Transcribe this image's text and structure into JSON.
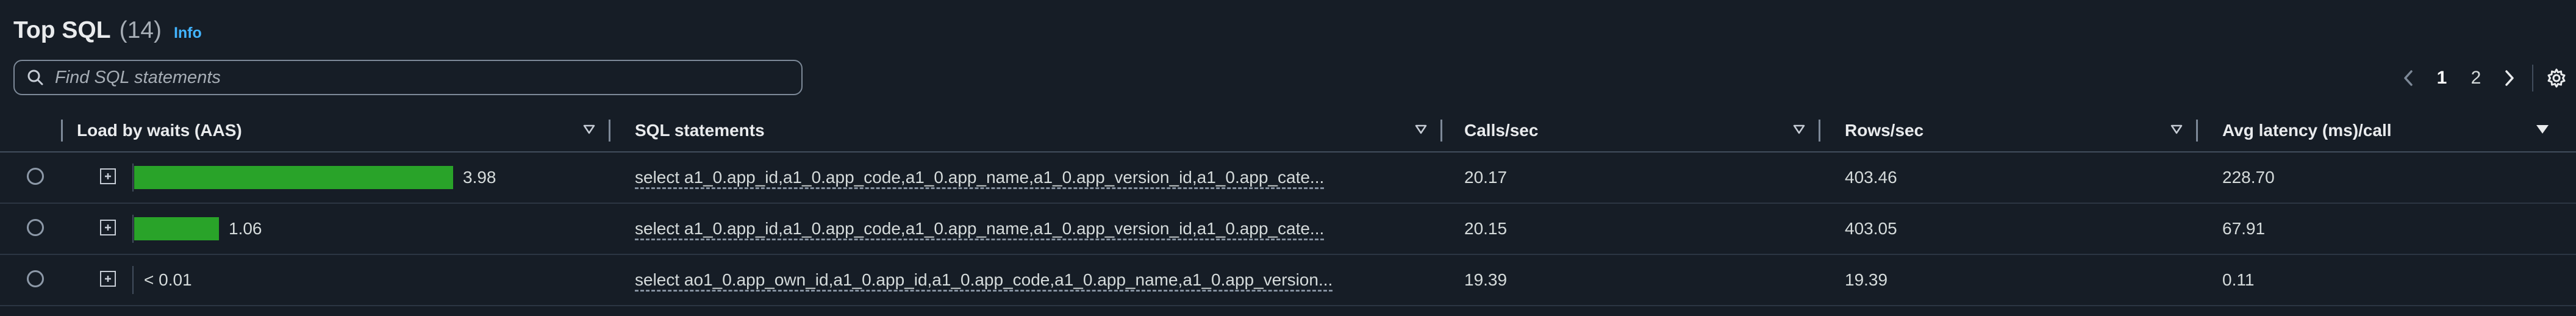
{
  "header": {
    "title": "Top SQL",
    "count": "(14)",
    "info_label": "Info"
  },
  "search": {
    "placeholder": "Find SQL statements",
    "value": ""
  },
  "pagination": {
    "pages": [
      "1",
      "2"
    ],
    "current_page": "1"
  },
  "table": {
    "columns": [
      {
        "key": "load",
        "label": "Load by waits (AAS)"
      },
      {
        "key": "sql",
        "label": "SQL statements"
      },
      {
        "key": "calls",
        "label": "Calls/sec"
      },
      {
        "key": "rows",
        "label": "Rows/sec"
      },
      {
        "key": "latency",
        "label": "Avg latency (ms)/call"
      }
    ],
    "bar_color": "#29a329",
    "bar_max": 3.98,
    "rows": [
      {
        "load_value": 3.98,
        "load_label": "3.98",
        "sql": "select a1_0.app_id,a1_0.app_code,a1_0.app_name,a1_0.app_version_id,a1_0.app_cate...",
        "calls": "20.17",
        "rows_per_sec": "403.46",
        "latency": "228.70"
      },
      {
        "load_value": 1.06,
        "load_label": "1.06",
        "sql": "select a1_0.app_id,a1_0.app_code,a1_0.app_name,a1_0.app_version_id,a1_0.app_cate...",
        "calls": "20.15",
        "rows_per_sec": "403.05",
        "latency": "67.91"
      },
      {
        "load_value": 0,
        "load_label": "< 0.01",
        "sql": "select ao1_0.app_own_id,a1_0.app_id,a1_0.app_code,a1_0.app_name,a1_0.app_version...",
        "calls": "19.39",
        "rows_per_sec": "19.39",
        "latency": "0.11"
      }
    ]
  }
}
